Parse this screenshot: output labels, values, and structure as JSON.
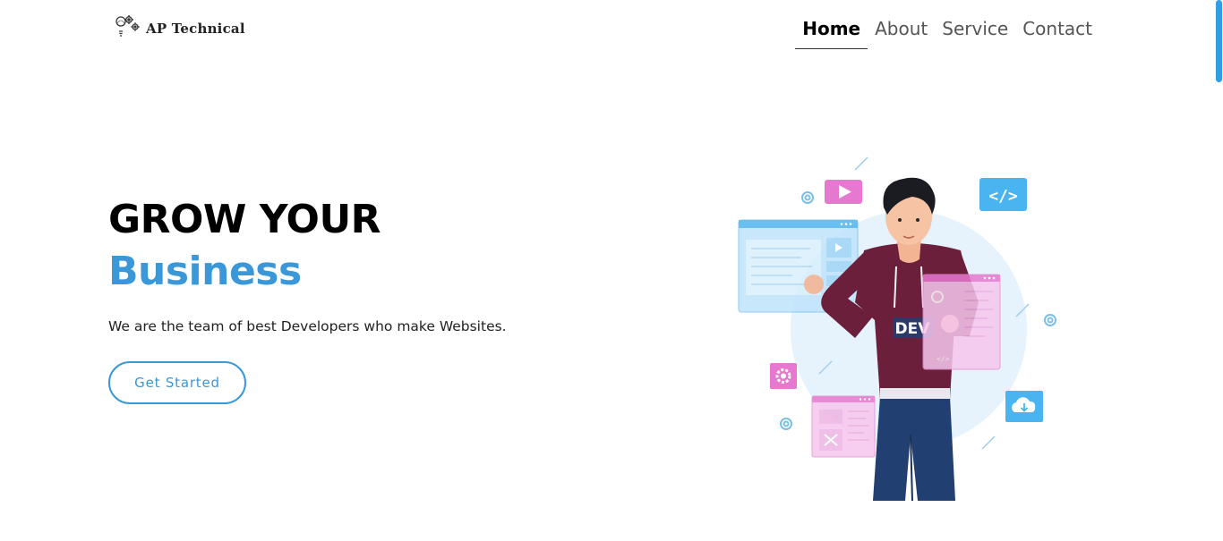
{
  "brand": {
    "name": "AP Technical",
    "logo_icon": "gears-lightbulb-icon"
  },
  "nav": {
    "items": [
      {
        "label": "Home",
        "active": true
      },
      {
        "label": "About",
        "active": false
      },
      {
        "label": "Service",
        "active": false
      },
      {
        "label": "Contact",
        "active": false
      }
    ]
  },
  "hero": {
    "headline": "GROW YOUR",
    "headline_accent": "Business",
    "tagline": "We are the team of best Developers who make Websites.",
    "cta_label": "Get Started",
    "illustration": {
      "hoodie_text": "DEV",
      "icons": [
        "play-icon",
        "code-icon",
        "cloud-download-icon",
        "settings-icon",
        "target-icon"
      ]
    }
  },
  "colors": {
    "accent": "#3a97d8",
    "scroll_thumb": "#2f9ee6",
    "text": "#111111"
  }
}
